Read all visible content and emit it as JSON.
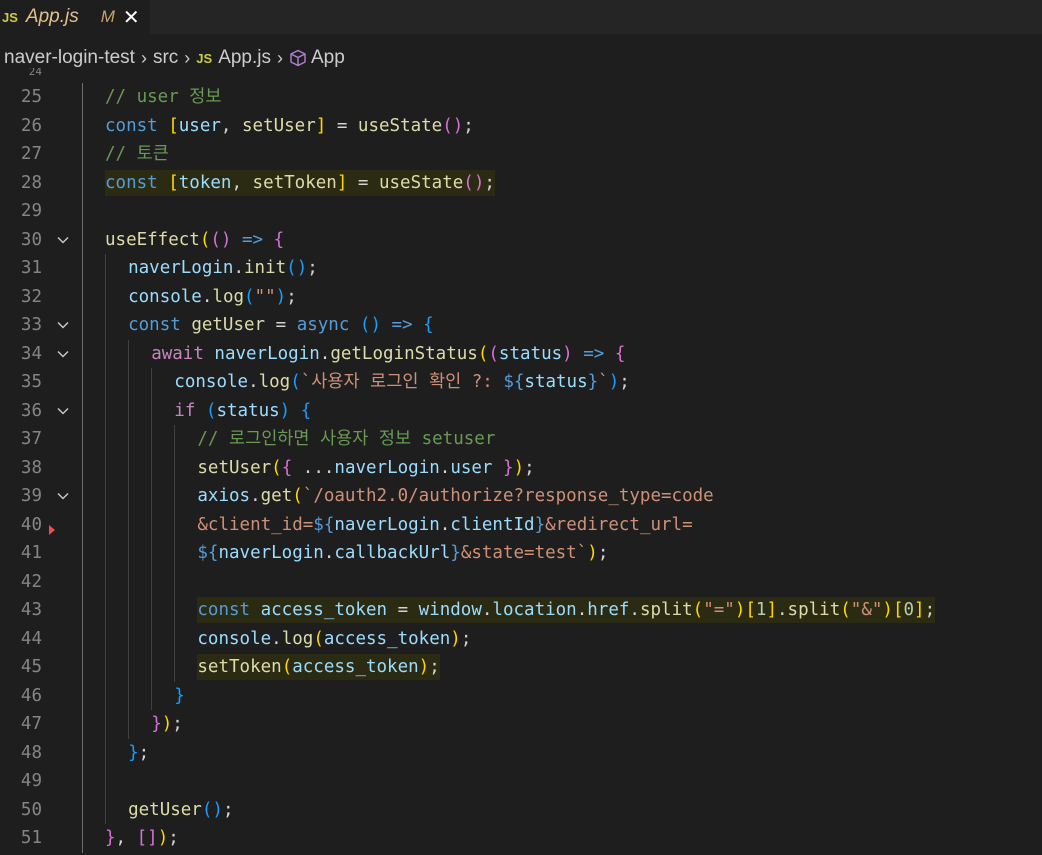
{
  "tab": {
    "icon": "JS",
    "filename": "App.js",
    "status": "M"
  },
  "breadcrumb": {
    "items": [
      "naver-login-test",
      "src",
      "App.js",
      "App"
    ],
    "file_icon": "JS"
  },
  "editor": {
    "lines": [
      {
        "n": "25",
        "fold": false,
        "depth": 1,
        "t": [
          [
            "c-com",
            "// user 정보"
          ]
        ]
      },
      {
        "n": "26",
        "fold": false,
        "depth": 1,
        "t": [
          [
            "c-kw",
            "const "
          ],
          [
            "b1",
            "["
          ],
          [
            "c-var",
            "user"
          ],
          [
            "c-op",
            ", "
          ],
          [
            "c-fn",
            "setUser"
          ],
          [
            "b1",
            "]"
          ],
          [
            "c-op",
            " = "
          ],
          [
            "c-fn",
            "useState"
          ],
          [
            "b2",
            "()"
          ],
          [
            "c-op",
            ";"
          ]
        ]
      },
      {
        "n": "27",
        "fold": false,
        "depth": 1,
        "t": [
          [
            "c-com",
            "// 토큰"
          ]
        ]
      },
      {
        "n": "28",
        "fold": false,
        "depth": 1,
        "t": [
          [
            "c-kw",
            "const "
          ],
          [
            "b1",
            "["
          ],
          [
            "c-var",
            "token"
          ],
          [
            "c-op",
            ", "
          ],
          [
            "c-fn",
            "setToken"
          ],
          [
            "b1",
            "]"
          ],
          [
            "c-op",
            " = "
          ],
          [
            "c-fn",
            "useState"
          ],
          [
            "b2",
            "()"
          ],
          [
            "c-op",
            ";"
          ]
        ],
        "hl": true
      },
      {
        "n": "29",
        "fold": false,
        "depth": 1,
        "t": []
      },
      {
        "n": "30",
        "fold": true,
        "depth": 1,
        "t": [
          [
            "c-fn",
            "useEffect"
          ],
          [
            "b1",
            "("
          ],
          [
            "b2",
            "()"
          ],
          [
            "c-kw",
            " => "
          ],
          [
            "b2",
            "{"
          ]
        ]
      },
      {
        "n": "31",
        "fold": false,
        "depth": 2,
        "t": [
          [
            "c-var",
            "naverLogin"
          ],
          [
            "c-op",
            "."
          ],
          [
            "c-fn",
            "init"
          ],
          [
            "b3",
            "()"
          ],
          [
            "c-op",
            ";"
          ]
        ]
      },
      {
        "n": "32",
        "fold": false,
        "depth": 2,
        "t": [
          [
            "c-var",
            "console"
          ],
          [
            "c-op",
            "."
          ],
          [
            "c-fn",
            "log"
          ],
          [
            "b3",
            "("
          ],
          [
            "c-str",
            "\"\""
          ],
          [
            "b3",
            ")"
          ],
          [
            "c-op",
            ";"
          ]
        ]
      },
      {
        "n": "33",
        "fold": true,
        "depth": 2,
        "t": [
          [
            "c-kw",
            "const "
          ],
          [
            "c-fn",
            "getUser"
          ],
          [
            "c-op",
            " = "
          ],
          [
            "c-kw",
            "async "
          ],
          [
            "b3",
            "()"
          ],
          [
            "c-kw",
            " => "
          ],
          [
            "b3",
            "{"
          ]
        ]
      },
      {
        "n": "34",
        "fold": true,
        "depth": 3,
        "t": [
          [
            "c-ctl",
            "await "
          ],
          [
            "c-var",
            "naverLogin"
          ],
          [
            "c-op",
            "."
          ],
          [
            "c-fn",
            "getLoginStatus"
          ],
          [
            "b1",
            "("
          ],
          [
            "b2",
            "("
          ],
          [
            "c-var",
            "status"
          ],
          [
            "b2",
            ")"
          ],
          [
            "c-kw",
            " => "
          ],
          [
            "b2",
            "{"
          ]
        ]
      },
      {
        "n": "35",
        "fold": false,
        "depth": 4,
        "t": [
          [
            "c-var",
            "console"
          ],
          [
            "c-op",
            "."
          ],
          [
            "c-fn",
            "log"
          ],
          [
            "b3",
            "("
          ],
          [
            "c-str",
            "`사용자 로그인 확인 ?: "
          ],
          [
            "c-kw",
            "${"
          ],
          [
            "c-var",
            "status"
          ],
          [
            "c-kw",
            "}"
          ],
          [
            "c-str",
            "`"
          ],
          [
            "b3",
            ")"
          ],
          [
            "c-op",
            ";"
          ]
        ]
      },
      {
        "n": "36",
        "fold": true,
        "depth": 4,
        "t": [
          [
            "c-ctl",
            "if "
          ],
          [
            "b3",
            "("
          ],
          [
            "c-var",
            "status"
          ],
          [
            "b3",
            ")"
          ],
          [
            "c-op",
            " "
          ],
          [
            "b3",
            "{"
          ]
        ]
      },
      {
        "n": "37",
        "fold": false,
        "depth": 5,
        "t": [
          [
            "c-com",
            "// 로그인하면 사용자 정보 setuser"
          ]
        ]
      },
      {
        "n": "38",
        "fold": false,
        "depth": 5,
        "t": [
          [
            "c-fn",
            "setUser"
          ],
          [
            "b1",
            "("
          ],
          [
            "b2",
            "{"
          ],
          [
            "c-op",
            " ..."
          ],
          [
            "c-var",
            "naverLogin"
          ],
          [
            "c-op",
            "."
          ],
          [
            "c-var",
            "user"
          ],
          [
            "c-op",
            " "
          ],
          [
            "b2",
            "}"
          ],
          [
            "b1",
            ")"
          ],
          [
            "c-op",
            ";"
          ]
        ]
      },
      {
        "n": "39",
        "fold": true,
        "depth": 5,
        "t": [
          [
            "c-var",
            "axios"
          ],
          [
            "c-op",
            "."
          ],
          [
            "c-fn",
            "get"
          ],
          [
            "b1",
            "("
          ],
          [
            "c-str",
            "`/oauth2.0/authorize?response_type=code"
          ]
        ]
      },
      {
        "n": "40",
        "fold": false,
        "depth": 5,
        "t": [
          [
            "c-str",
            "&client_id="
          ],
          [
            "c-kw",
            "${"
          ],
          [
            "c-var",
            "naverLogin"
          ],
          [
            "c-op",
            "."
          ],
          [
            "c-var",
            "clientId"
          ],
          [
            "c-kw",
            "}"
          ],
          [
            "c-str",
            "&redirect_url="
          ]
        ]
      },
      {
        "n": "41",
        "fold": false,
        "depth": 5,
        "t": [
          [
            "c-kw",
            "${"
          ],
          [
            "c-var",
            "naverLogin"
          ],
          [
            "c-op",
            "."
          ],
          [
            "c-var",
            "callbackUrl"
          ],
          [
            "c-kw",
            "}"
          ],
          [
            "c-str",
            "&state=test`"
          ],
          [
            "b1",
            ")"
          ],
          [
            "c-op",
            ";"
          ]
        ]
      },
      {
        "n": "42",
        "fold": false,
        "depth": 5,
        "t": []
      },
      {
        "n": "43",
        "fold": false,
        "depth": 5,
        "t": [
          [
            "c-kw",
            "const "
          ],
          [
            "c-var",
            "access_token"
          ],
          [
            "c-op",
            " = "
          ],
          [
            "c-var",
            "window"
          ],
          [
            "c-op",
            "."
          ],
          [
            "c-var",
            "location"
          ],
          [
            "c-op",
            "."
          ],
          [
            "c-var",
            "href"
          ],
          [
            "c-op",
            "."
          ],
          [
            "c-fn",
            "split"
          ],
          [
            "b1",
            "("
          ],
          [
            "c-str",
            "\"=\""
          ],
          [
            "b1",
            ")"
          ],
          [
            "b1",
            "["
          ],
          [
            "c-num",
            "1"
          ],
          [
            "b1",
            "]"
          ],
          [
            "c-op",
            "."
          ],
          [
            "c-fn",
            "split"
          ],
          [
            "b1",
            "("
          ],
          [
            "c-str",
            "\"&\""
          ],
          [
            "b1",
            ")"
          ],
          [
            "b1",
            "["
          ],
          [
            "c-num",
            "0"
          ],
          [
            "b1",
            "]"
          ],
          [
            "c-op",
            ";"
          ]
        ],
        "hl": true
      },
      {
        "n": "44",
        "fold": false,
        "depth": 5,
        "t": [
          [
            "c-var",
            "console"
          ],
          [
            "c-op",
            "."
          ],
          [
            "c-fn",
            "log"
          ],
          [
            "b1",
            "("
          ],
          [
            "c-var",
            "access_token"
          ],
          [
            "b1",
            ")"
          ],
          [
            "c-op",
            ";"
          ]
        ]
      },
      {
        "n": "45",
        "fold": false,
        "depth": 5,
        "t": [
          [
            "c-fn",
            "setToken"
          ],
          [
            "b1",
            "("
          ],
          [
            "c-var",
            "access_token"
          ],
          [
            "b1",
            ")"
          ],
          [
            "c-op",
            ";"
          ]
        ],
        "hl": true
      },
      {
        "n": "46",
        "fold": false,
        "depth": 4,
        "t": [
          [
            "b3",
            "}"
          ]
        ]
      },
      {
        "n": "47",
        "fold": false,
        "depth": 3,
        "t": [
          [
            "b2",
            "}"
          ],
          [
            "b1",
            ")"
          ],
          [
            "c-op",
            ";"
          ]
        ]
      },
      {
        "n": "48",
        "fold": false,
        "depth": 2,
        "t": [
          [
            "b3",
            "}"
          ],
          [
            "c-op",
            ";"
          ]
        ]
      },
      {
        "n": "49",
        "fold": false,
        "depth": 2,
        "t": []
      },
      {
        "n": "50",
        "fold": false,
        "depth": 2,
        "t": [
          [
            "c-fn",
            "getUser"
          ],
          [
            "b3",
            "()"
          ],
          [
            "c-op",
            ";"
          ]
        ]
      },
      {
        "n": "51",
        "fold": false,
        "depth": 1,
        "t": [
          [
            "b2",
            "}"
          ],
          [
            "c-op",
            ", "
          ],
          [
            "b2",
            "[]"
          ],
          [
            "b1",
            ")"
          ],
          [
            "c-op",
            ";"
          ]
        ]
      }
    ]
  }
}
